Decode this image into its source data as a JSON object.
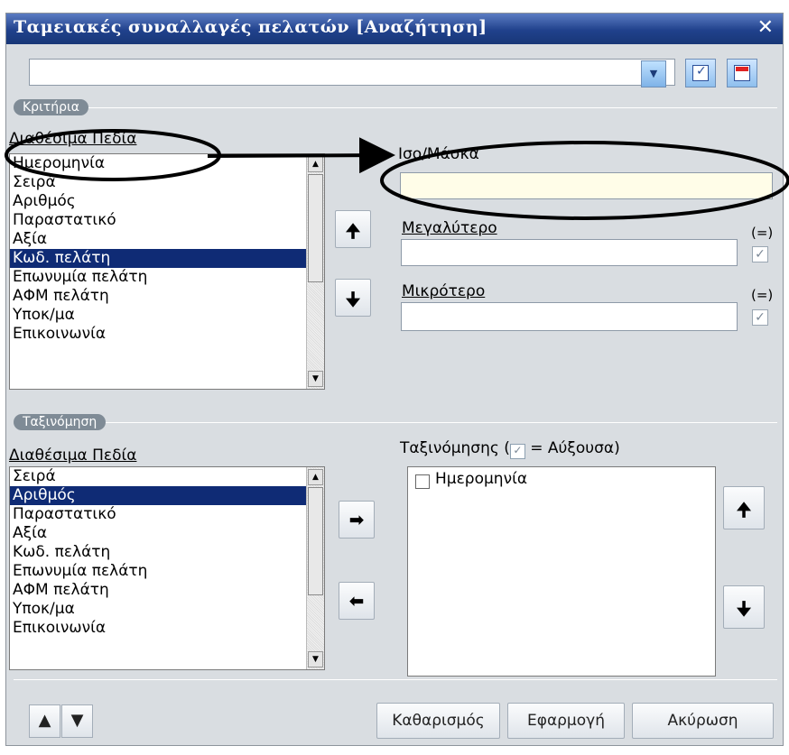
{
  "window": {
    "title": "Ταμειακές συναλλαγές πελατών [Αναζήτηση]",
    "close_glyph": "✕"
  },
  "preset": {
    "value": "",
    "dropdown_glyph": "▼"
  },
  "criteria": {
    "group_label": "Κριτήρια",
    "fields_label": "Διαθέσιμα Πεδία",
    "items": [
      "Ημερομηνία",
      "Σειρά",
      "Αριθμός",
      "Παραστατικό",
      "Αξία",
      "Κωδ. πελάτη",
      "Επωνυμία πελάτη",
      "ΑΦΜ πελάτη",
      "Υποκ/μα",
      "Επικοινωνία"
    ],
    "selected_index": 5,
    "equal_label": "Ισο/Μάσκα",
    "greater_label": "Μεγαλύτερο",
    "less_label": "Μικρότερο",
    "inclusive_label": "(=)",
    "up_glyph": "🠉",
    "down_glyph": "🠋"
  },
  "sorting": {
    "group_label": "Ταξινόμηση",
    "fields_label": "Διαθέσιμα Πεδία",
    "items": [
      "Σειρά",
      "Αριθμός",
      "Παραστατικό",
      "Αξία",
      "Κωδ. πελάτη",
      "Επωνυμία πελάτη",
      "ΑΦΜ πελάτη",
      "Υποκ/μα",
      "Επικοινωνία"
    ],
    "selected_index": 1,
    "sort_label_prefix": "Ταξινόμησης (",
    "sort_label_suffix": " = Αύξουσα)",
    "sort_items": [
      "Ημερομηνία"
    ],
    "add_glyph": "➡",
    "remove_glyph": "⬅",
    "up_glyph": "🠉",
    "down_glyph": "🠋"
  },
  "footer": {
    "clear_label": "Καθαρισμός",
    "apply_label": "Εφαρμογή",
    "cancel_label": "Ακύρωση",
    "nav_up_glyph": "▲",
    "nav_down_glyph": "▼"
  },
  "colors": {
    "title_bar": "#20418c",
    "selection": "#0f2b75",
    "annotation": "#000000"
  }
}
